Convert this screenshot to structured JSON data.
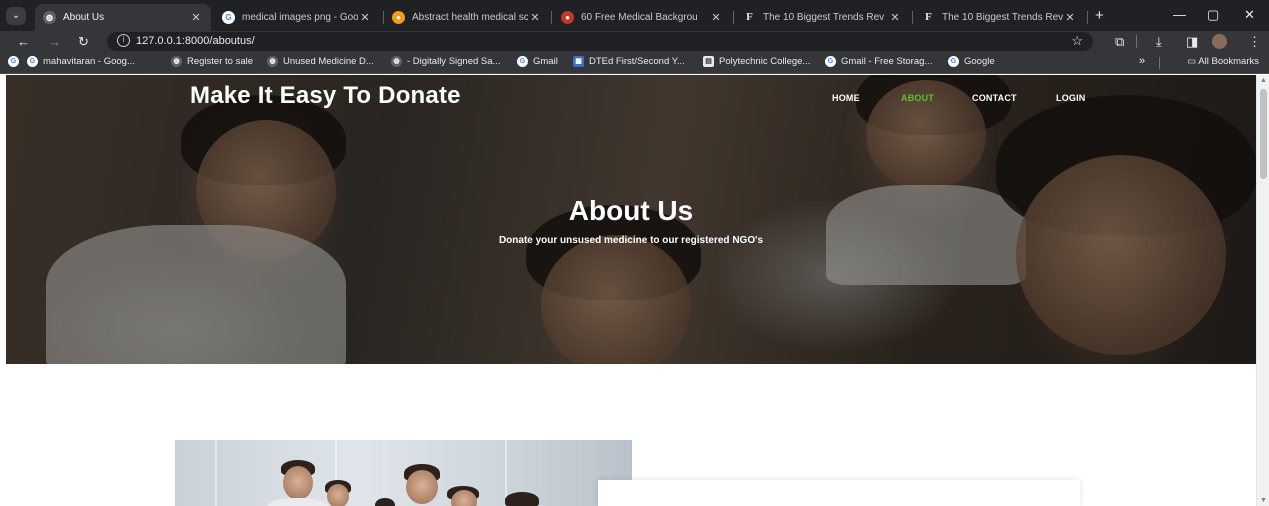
{
  "browser": {
    "tabs": [
      {
        "title": "About Us",
        "active": true,
        "favicon": "globe-icon"
      },
      {
        "title": "medical images png - Goo",
        "active": false,
        "favicon": "google-icon"
      },
      {
        "title": "Abstract health medical sc",
        "active": false,
        "favicon": "orange-badge-icon"
      },
      {
        "title": "60 Free Medical Backgrou",
        "active": false,
        "favicon": "red-circle-icon"
      },
      {
        "title": "The 10 Biggest Trends Rev",
        "active": false,
        "favicon": "f-logo-icon"
      },
      {
        "title": "The 10 Biggest Trends Rev",
        "active": false,
        "favicon": "f-logo-icon"
      }
    ],
    "tab_close_glyph": "✕",
    "new_tab_glyph": "+",
    "f_logo_letter": "F",
    "address": "127.0.0.1:8000/aboutus/",
    "bookmarks": [
      {
        "label": "mahavitaran - Goog...",
        "favicon": "google-icon"
      },
      {
        "label": "Register to sale",
        "favicon": "globe-icon"
      },
      {
        "label": "Unused Medicine D...",
        "favicon": "globe-icon"
      },
      {
        "label": "- Digitally Signed Sa...",
        "favicon": "globe-icon"
      },
      {
        "label": "Gmail",
        "favicon": "google-icon"
      },
      {
        "label": "DTEd First/Second Y...",
        "favicon": "dted-icon"
      },
      {
        "label": "Polytechnic College...",
        "favicon": "college-icon"
      },
      {
        "label": "Gmail - Free Storag...",
        "favicon": "google-icon"
      },
      {
        "label": "Google",
        "favicon": "google-icon"
      }
    ],
    "bookmarks_overflow": "»",
    "all_bookmarks": "All Bookmarks"
  },
  "site": {
    "logo": "Make It Easy To Donate",
    "nav": [
      {
        "label": "HOME",
        "active": false
      },
      {
        "label": "ABOUT",
        "active": true
      },
      {
        "label": "CONTACT",
        "active": false
      },
      {
        "label": "LOGIN",
        "active": false
      }
    ],
    "hero_title": "About Us",
    "hero_subtitle": "Donate your unsused medicine to our registered NGO's"
  },
  "colors": {
    "nav_active": "#5fbf2a",
    "chrome_dark": "#202124",
    "chrome_toolbar": "#35363a"
  }
}
